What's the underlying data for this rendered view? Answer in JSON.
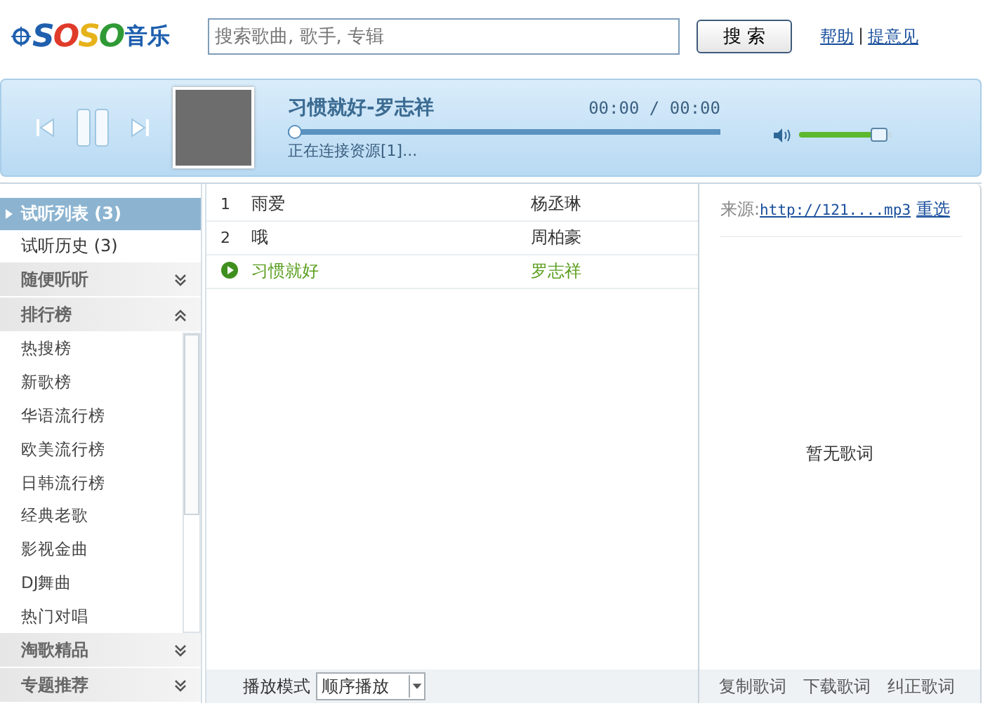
{
  "header": {
    "logo": {
      "brand": "SOSO",
      "suffix": "音乐"
    },
    "search": {
      "placeholder": "搜索歌曲, 歌手, 专辑"
    },
    "search_button": "搜 索",
    "links": [
      "帮助",
      "提意见"
    ],
    "separator": "|"
  },
  "player": {
    "playing": true,
    "title": "习惯就好-罗志祥",
    "time": "00:00 / 00:00",
    "status": "正在连接资源[1]...",
    "progress": {
      "level": 0
    },
    "volume": {
      "level": 0.95
    }
  },
  "sidebar": [
    {
      "kind": "tab",
      "label": "试听列表 (3)",
      "selected": true
    },
    {
      "kind": "tab",
      "label": "试听历史 (3)",
      "selected": false
    },
    {
      "kind": "section",
      "label": "随便听听",
      "expanded": false
    },
    {
      "kind": "section",
      "label": "排行榜",
      "expanded": true,
      "children": [
        {
          "label": "热搜榜"
        },
        {
          "label": "新歌榜"
        },
        {
          "label": "华语流行榜"
        },
        {
          "label": "欧美流行榜"
        },
        {
          "label": "日韩流行榜"
        },
        {
          "label": "经典老歌"
        },
        {
          "label": "影视金曲"
        },
        {
          "label": "DJ舞曲"
        },
        {
          "label": "热门对唱"
        }
      ]
    },
    {
      "kind": "section",
      "label": "淘歌精品",
      "expanded": false
    },
    {
      "kind": "section",
      "label": "专题推荐",
      "expanded": false
    }
  ],
  "tracks": [
    {
      "number": "1",
      "title": "雨爱",
      "artist": "杨丞琳",
      "playing": false
    },
    {
      "number": "2",
      "title": "哦",
      "artist": "周柏豪",
      "playing": false
    },
    {
      "title": "习惯就好",
      "artist": "罗志祥",
      "playing": true
    }
  ],
  "play_mode": {
    "label": "播放模式",
    "value": "顺序播放"
  },
  "lyrics": {
    "source_label": "来源:",
    "source_url": "http://121....mp3",
    "reselect": "重选",
    "empty": "暂无歌词",
    "actions": [
      "复制歌词",
      "下载歌词",
      "纠正歌词"
    ]
  }
}
